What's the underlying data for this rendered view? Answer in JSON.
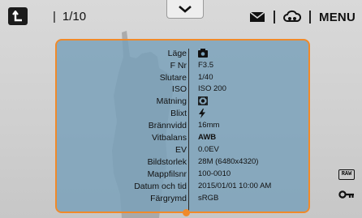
{
  "top_bar": {
    "counter": "1/10",
    "menu_label": "MENU"
  },
  "icons": {
    "back": "back-arrow-icon",
    "expand": "chevron-down-icon",
    "email": "envelope-icon",
    "share": "cloud-share-icon",
    "raw": "raw-badge-icon",
    "protect": "key-icon"
  },
  "raw_badge_text": "RAW",
  "info": {
    "rows": [
      {
        "label": "Läge",
        "value": "",
        "icon": "camera-mode-icon"
      },
      {
        "label": "F Nr",
        "value": "F3.5"
      },
      {
        "label": "Slutare",
        "value": "1/40"
      },
      {
        "label": "ISO",
        "value": "ISO 200"
      },
      {
        "label": "Mätning",
        "value": "",
        "icon": "metering-icon"
      },
      {
        "label": "Blixt",
        "value": "",
        "icon": "flash-icon"
      },
      {
        "label": "Brännvidd",
        "value": "16mm"
      },
      {
        "label": "Vitbalans",
        "value": "AWB"
      },
      {
        "label": "EV",
        "value": "0.0EV"
      },
      {
        "label": "Bildstorlek",
        "value": "28M (6480x4320)"
      },
      {
        "label": "Mappfilsnr",
        "value": "100-0010"
      },
      {
        "label": "Datum och tid",
        "value": "2015/01/01 10:00 AM"
      },
      {
        "label": "Färgrymd",
        "value": "sRGB"
      }
    ]
  },
  "colors": {
    "accent_orange": "#f08a2a",
    "panel_blue": "#78a0b9"
  }
}
